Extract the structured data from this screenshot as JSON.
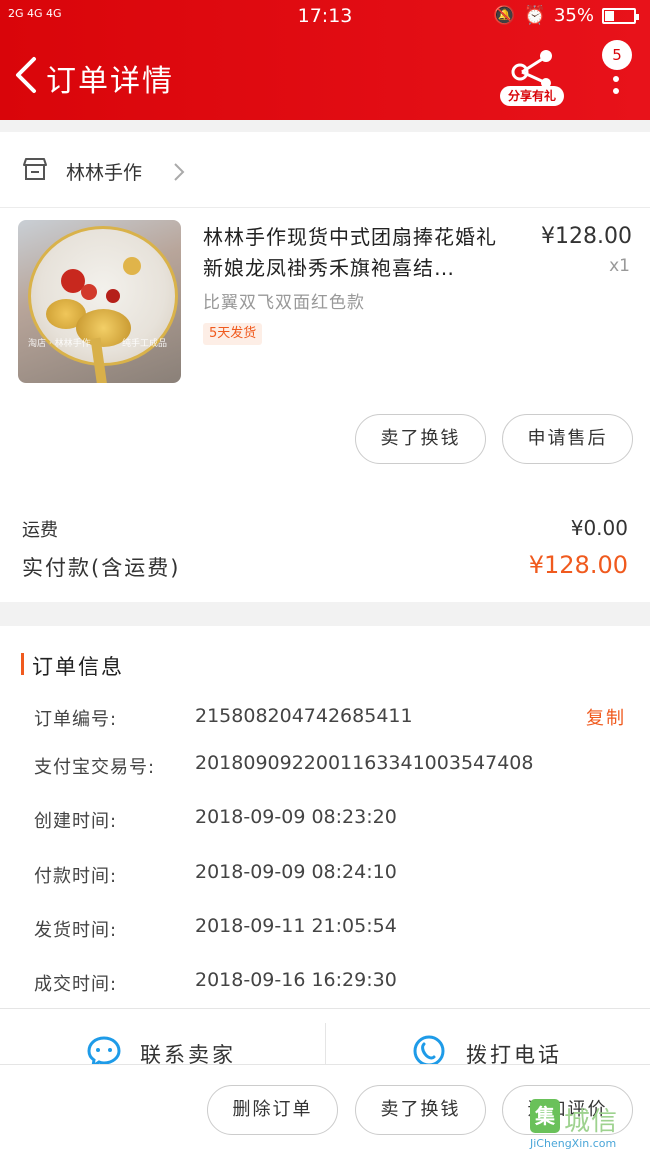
{
  "status_bar": {
    "network": "2G 4G 4G",
    "time": "17:13",
    "battery": "35%"
  },
  "nav": {
    "title": "订单详情",
    "share_label": "分享有礼",
    "more_badge": "5"
  },
  "shop": {
    "name": "林林手作"
  },
  "product": {
    "title": "林林手作现货中式团扇捧花婚礼新娘龙凤褂秀禾旗袍喜结…",
    "price": "¥128.00",
    "quantity": "x1",
    "sku": "比翼双飞双面红色款",
    "tag": "5天发货",
    "image_caption_left": "淘店 · 林林手作",
    "image_caption_right": "纯手工成品"
  },
  "item_actions": {
    "buy_again": "卖了换钱",
    "after_sales": "申请售后"
  },
  "fees": {
    "shipping_label": "运费",
    "shipping_value": "¥0.00",
    "paid_label": "实付款(含运费)",
    "paid_value": "¥128.00"
  },
  "order_info": {
    "title": "订单信息",
    "copy_label": "复制",
    "rows": [
      {
        "label": "订单编号:",
        "value": "215808204742685411"
      },
      {
        "label": "支付宝交易号:",
        "value": "2018090922001163341003547408"
      },
      {
        "label": "创建时间:",
        "value": "2018-09-09 08:23:20"
      },
      {
        "label": "付款时间:",
        "value": "2018-09-09 08:24:10"
      },
      {
        "label": "发货时间:",
        "value": "2018-09-11 21:05:54"
      },
      {
        "label": "成交时间:",
        "value": "2018-09-16 16:29:30"
      }
    ]
  },
  "contact": {
    "seller_label": "联系卖家",
    "phone_label": "拨打电话"
  },
  "bottom_actions": {
    "delete_order": "删除订单",
    "sell": "卖了换钱",
    "review": "追加评价"
  },
  "watermark": {
    "box_char": "集",
    "text": "城信",
    "url": "JiChengXin.com"
  },
  "colors": {
    "header_red": "#e0080f",
    "accent_orange": "#f05a1e"
  }
}
